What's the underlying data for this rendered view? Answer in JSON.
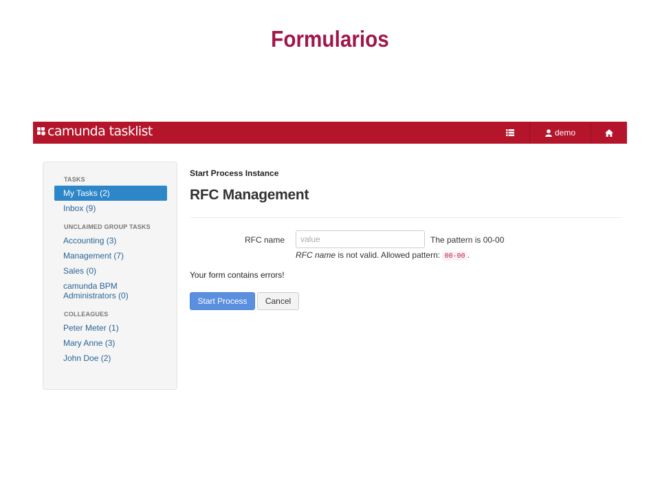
{
  "slide": {
    "title": "Formularios"
  },
  "navbar": {
    "brand": "camunda tasklist",
    "user_label": "demo",
    "icons": [
      "list-icon",
      "user-icon",
      "home-icon"
    ],
    "color": "#b5152b"
  },
  "sidebar": {
    "tasks_header": "TASKS",
    "tasks": [
      {
        "label": "My Tasks (2)",
        "active": true
      },
      {
        "label": "Inbox (9)",
        "active": false
      }
    ],
    "group_header": "UNCLAIMED GROUP TASKS",
    "groups": [
      {
        "label": "Accounting (3)"
      },
      {
        "label": "Management (7)"
      },
      {
        "label": "Sales (0)"
      },
      {
        "label": "camunda BPM Administrators (0)"
      }
    ],
    "colleagues_header": "COLLEAGUES",
    "colleagues": [
      {
        "label": "Peter Meter (1)"
      },
      {
        "label": "Mary Anne (3)"
      },
      {
        "label": "John Doe (2)"
      }
    ]
  },
  "main": {
    "breadcrumb": "Start Process Instance",
    "title": "RFC Management",
    "form": {
      "field_label": "RFC name",
      "field_placeholder": "value",
      "field_value": "",
      "hint": "The pattern is 00-00",
      "error_field": "RFC name",
      "error_text": "is not valid. Allowed pattern:",
      "error_pattern": "00-00",
      "error_end": ".",
      "form_error": "Your form contains errors!"
    },
    "buttons": {
      "submit": "Start Process",
      "cancel": "Cancel"
    }
  }
}
